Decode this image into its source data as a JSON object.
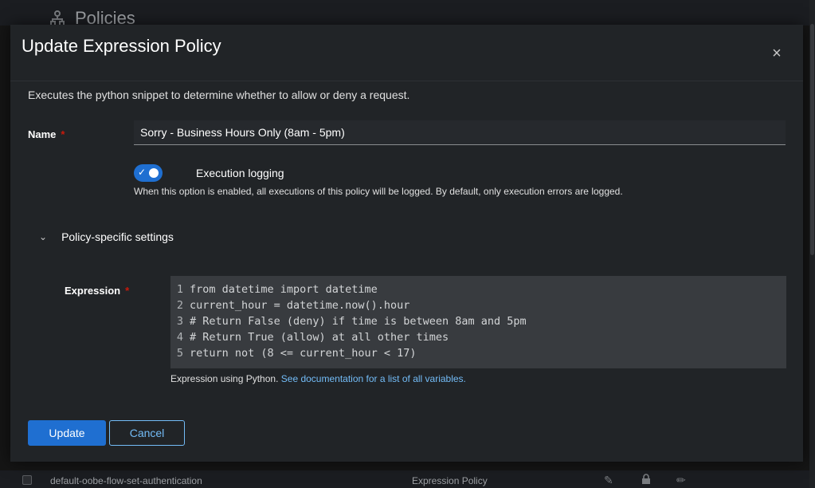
{
  "background": {
    "page_title": "Policies",
    "row": {
      "name": "default-oobe-flow-set-authentication",
      "type": "Expression Policy"
    }
  },
  "modal": {
    "title": "Update Expression Policy",
    "description": "Executes the python snippet to determine whether to allow or deny a request.",
    "name_field": {
      "label": "Name",
      "required_mark": "*",
      "value": "Sorry - Business Hours Only (8am - 5pm)"
    },
    "execution_logging": {
      "enabled": true,
      "label": "Execution logging",
      "helper": "When this option is enabled, all executions of this policy will be logged. By default, only execution errors are logged."
    },
    "section": {
      "label": "Policy-specific settings",
      "expanded": true
    },
    "expression": {
      "label": "Expression",
      "required_mark": "*",
      "lines": [
        {
          "n": "1",
          "text": "from datetime import datetime"
        },
        {
          "n": "2",
          "text": "current_hour = datetime.now().hour"
        },
        {
          "n": "3",
          "text": "# Return False (deny) if time is between 8am and 5pm"
        },
        {
          "n": "4",
          "text": "# Return True (allow) at all other times"
        },
        {
          "n": "5",
          "text": "return not (8 <= current_hour < 17)"
        }
      ],
      "help_text": "Expression using Python.",
      "help_link": "See documentation for a list of all variables."
    },
    "buttons": {
      "update": "Update",
      "cancel": "Cancel"
    }
  },
  "colors": {
    "accent": "#1f6fd1",
    "link": "#73bcf7",
    "required": "#c9190b"
  }
}
